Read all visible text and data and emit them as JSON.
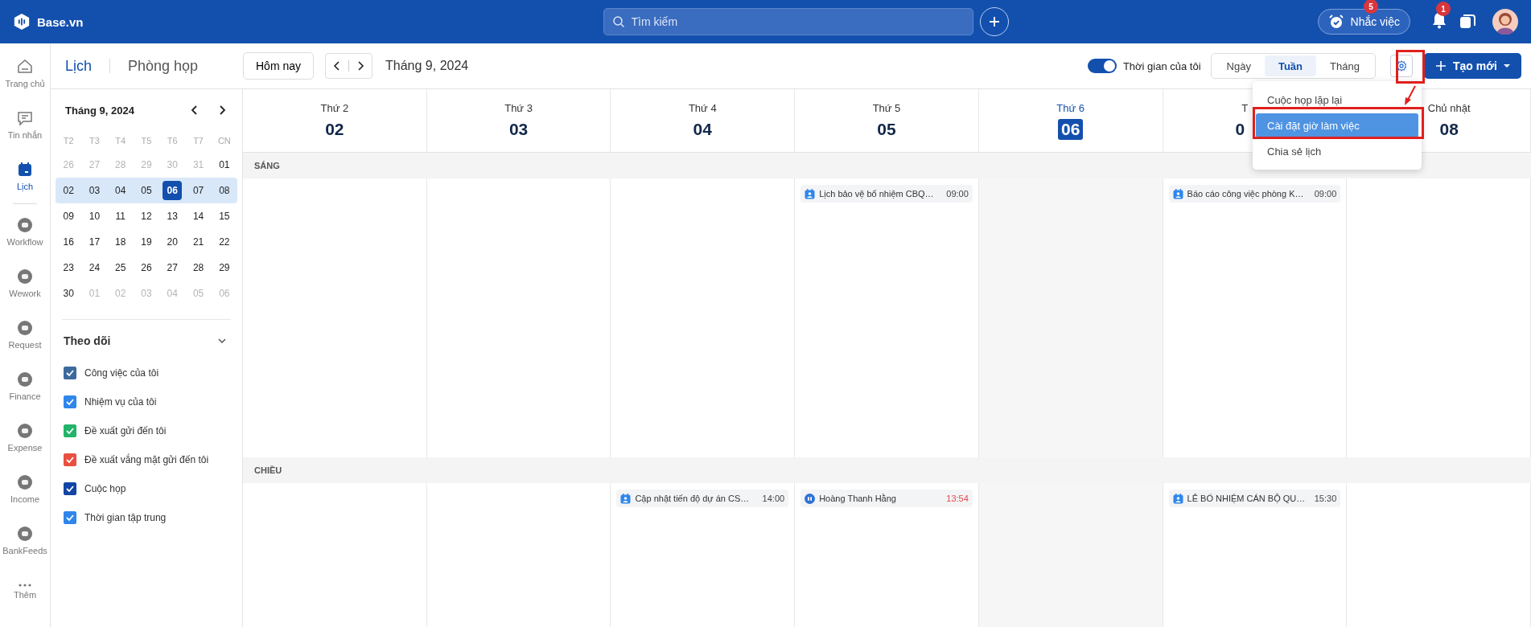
{
  "topbar": {
    "brand": "Base.vn",
    "search": {
      "placeholder": "Tìm kiếm"
    },
    "reminder": {
      "label": "Nhắc việc",
      "badge": "5"
    },
    "notifications": {
      "badge": "1"
    }
  },
  "rail": [
    {
      "label": "Trang chủ",
      "kind": "home",
      "selected": false
    },
    {
      "label": "Tin nhắn",
      "kind": "chat",
      "selected": false
    },
    {
      "label": "Lịch",
      "kind": "calendar",
      "selected": true
    },
    {
      "label": "Workflow",
      "kind": "app",
      "selected": false
    },
    {
      "label": "Wework",
      "kind": "app",
      "selected": false
    },
    {
      "label": "Request",
      "kind": "app",
      "selected": false
    },
    {
      "label": "Finance",
      "kind": "app",
      "selected": false
    },
    {
      "label": "Expense",
      "kind": "app",
      "selected": false
    },
    {
      "label": "Income",
      "kind": "app",
      "selected": false
    },
    {
      "label": "BankFeeds",
      "kind": "app",
      "selected": false
    },
    {
      "label": "Thêm",
      "kind": "more",
      "selected": false
    }
  ],
  "module_tabs": [
    {
      "label": "Lịch",
      "selected": true
    },
    {
      "label": "Phòng họp",
      "selected": false
    }
  ],
  "toolbar": {
    "today_button": "Hôm nay",
    "period": "Tháng 9, 2024",
    "my_time": {
      "label": "Thời gian của tôi",
      "on": true
    },
    "views": [
      {
        "label": "Ngày",
        "selected": false
      },
      {
        "label": "Tuần",
        "selected": true
      },
      {
        "label": "Tháng",
        "selected": false
      }
    ],
    "create_button": "Tạo mới"
  },
  "settings_menu": [
    {
      "label": "Cuộc họp lặp lại",
      "selected": false
    },
    {
      "label": "Cài đặt giờ làm việc",
      "selected": true
    },
    {
      "label": "Chia sẻ lịch",
      "selected": false
    }
  ],
  "mini_calendar": {
    "title": "Tháng 9, 2024",
    "weekdays": [
      "T2",
      "T3",
      "T4",
      "T5",
      "T6",
      "T7",
      "CN"
    ],
    "weeks": [
      {
        "selected": false,
        "days": [
          {
            "label": "26",
            "muted": true,
            "today": false
          },
          {
            "label": "27",
            "muted": true,
            "today": false
          },
          {
            "label": "28",
            "muted": true,
            "today": false
          },
          {
            "label": "29",
            "muted": true,
            "today": false
          },
          {
            "label": "30",
            "muted": true,
            "today": false
          },
          {
            "label": "31",
            "muted": true,
            "today": false
          },
          {
            "label": "01",
            "muted": false,
            "today": false
          }
        ]
      },
      {
        "selected": true,
        "days": [
          {
            "label": "02",
            "muted": false,
            "today": false
          },
          {
            "label": "03",
            "muted": false,
            "today": false
          },
          {
            "label": "04",
            "muted": false,
            "today": false
          },
          {
            "label": "05",
            "muted": false,
            "today": false
          },
          {
            "label": "06",
            "muted": false,
            "today": true
          },
          {
            "label": "07",
            "muted": false,
            "today": false
          },
          {
            "label": "08",
            "muted": false,
            "today": false
          }
        ]
      },
      {
        "selected": false,
        "days": [
          {
            "label": "09",
            "muted": false,
            "today": false
          },
          {
            "label": "10",
            "muted": false,
            "today": false
          },
          {
            "label": "11",
            "muted": false,
            "today": false
          },
          {
            "label": "12",
            "muted": false,
            "today": false
          },
          {
            "label": "13",
            "muted": false,
            "today": false
          },
          {
            "label": "14",
            "muted": false,
            "today": false
          },
          {
            "label": "15",
            "muted": false,
            "today": false
          }
        ]
      },
      {
        "selected": false,
        "days": [
          {
            "label": "16",
            "muted": false,
            "today": false
          },
          {
            "label": "17",
            "muted": false,
            "today": false
          },
          {
            "label": "18",
            "muted": false,
            "today": false
          },
          {
            "label": "19",
            "muted": false,
            "today": false
          },
          {
            "label": "20",
            "muted": false,
            "today": false
          },
          {
            "label": "21",
            "muted": false,
            "today": false
          },
          {
            "label": "22",
            "muted": false,
            "today": false
          }
        ]
      },
      {
        "selected": false,
        "days": [
          {
            "label": "23",
            "muted": false,
            "today": false
          },
          {
            "label": "24",
            "muted": false,
            "today": false
          },
          {
            "label": "25",
            "muted": false,
            "today": false
          },
          {
            "label": "26",
            "muted": false,
            "today": false
          },
          {
            "label": "27",
            "muted": false,
            "today": false
          },
          {
            "label": "28",
            "muted": false,
            "today": false
          },
          {
            "label": "29",
            "muted": false,
            "today": false
          }
        ]
      },
      {
        "selected": false,
        "days": [
          {
            "label": "30",
            "muted": false,
            "today": false
          },
          {
            "label": "01",
            "muted": true,
            "today": false
          },
          {
            "label": "02",
            "muted": true,
            "today": false
          },
          {
            "label": "03",
            "muted": true,
            "today": false
          },
          {
            "label": "04",
            "muted": true,
            "today": false
          },
          {
            "label": "05",
            "muted": true,
            "today": false
          },
          {
            "label": "06",
            "muted": true,
            "today": false
          }
        ]
      }
    ]
  },
  "follow": {
    "title": "Theo dõi",
    "expanded": true,
    "items": [
      {
        "label": "Công việc của tôi",
        "checked": true,
        "color": "#3d6a9e"
      },
      {
        "label": "Nhiệm vụ của tôi",
        "checked": true,
        "color": "#2f86eb"
      },
      {
        "label": "Đề xuất gửi đến tôi",
        "checked": true,
        "color": "#21b46a"
      },
      {
        "label": "Đề xuất vắng mặt gửi đến tôi",
        "checked": true,
        "color": "#e9503f"
      },
      {
        "label": "Cuộc họp",
        "checked": true,
        "color": "#1345a6"
      },
      {
        "label": "Thời gian tập trung",
        "checked": true,
        "color": "#2f86eb"
      }
    ]
  },
  "week_days": [
    {
      "label": "Thứ 2",
      "date": "02",
      "today": false,
      "covered": false
    },
    {
      "label": "Thứ 3",
      "date": "03",
      "today": false,
      "covered": false
    },
    {
      "label": "Thứ 4",
      "date": "04",
      "today": false,
      "covered": false
    },
    {
      "label": "Thứ 5",
      "date": "05",
      "today": false,
      "covered": false
    },
    {
      "label": "Thứ 6",
      "date": "06",
      "today": true,
      "covered": false
    },
    {
      "label": "T",
      "date": "0",
      "today": false,
      "covered": true
    },
    {
      "label": "Chủ nhật",
      "date": "08",
      "today": false,
      "covered": false
    }
  ],
  "sections": [
    {
      "label": "SÁNG",
      "columns": [
        {},
        {},
        {},
        {
          "events": [
            {
              "kind": "meeting",
              "title": "Lịch bảo vệ bổ nhiệm CBQ…",
              "time": "09:00",
              "overdue": false
            }
          ]
        },
        {},
        {
          "events": [
            {
              "kind": "meeting",
              "title": "Báo cáo công việc phòng K…",
              "time": "09:00",
              "overdue": false
            }
          ]
        },
        {}
      ]
    },
    {
      "label": "CHIỀU",
      "columns": [
        {},
        {},
        {
          "events": [
            {
              "kind": "meeting",
              "title": "Cập nhật tiến độ dự án CS…",
              "time": "14:00",
              "overdue": false
            }
          ]
        },
        {
          "events": [
            {
              "kind": "workflow",
              "title": "Hoàng Thanh Hằng",
              "time": "13:54",
              "overdue": true
            }
          ]
        },
        {},
        {
          "events": [
            {
              "kind": "meeting",
              "title": "LỄ BỔ NHIỆM CÁN BỘ QU…",
              "time": "15:30",
              "overdue": false
            }
          ]
        },
        {}
      ]
    }
  ]
}
